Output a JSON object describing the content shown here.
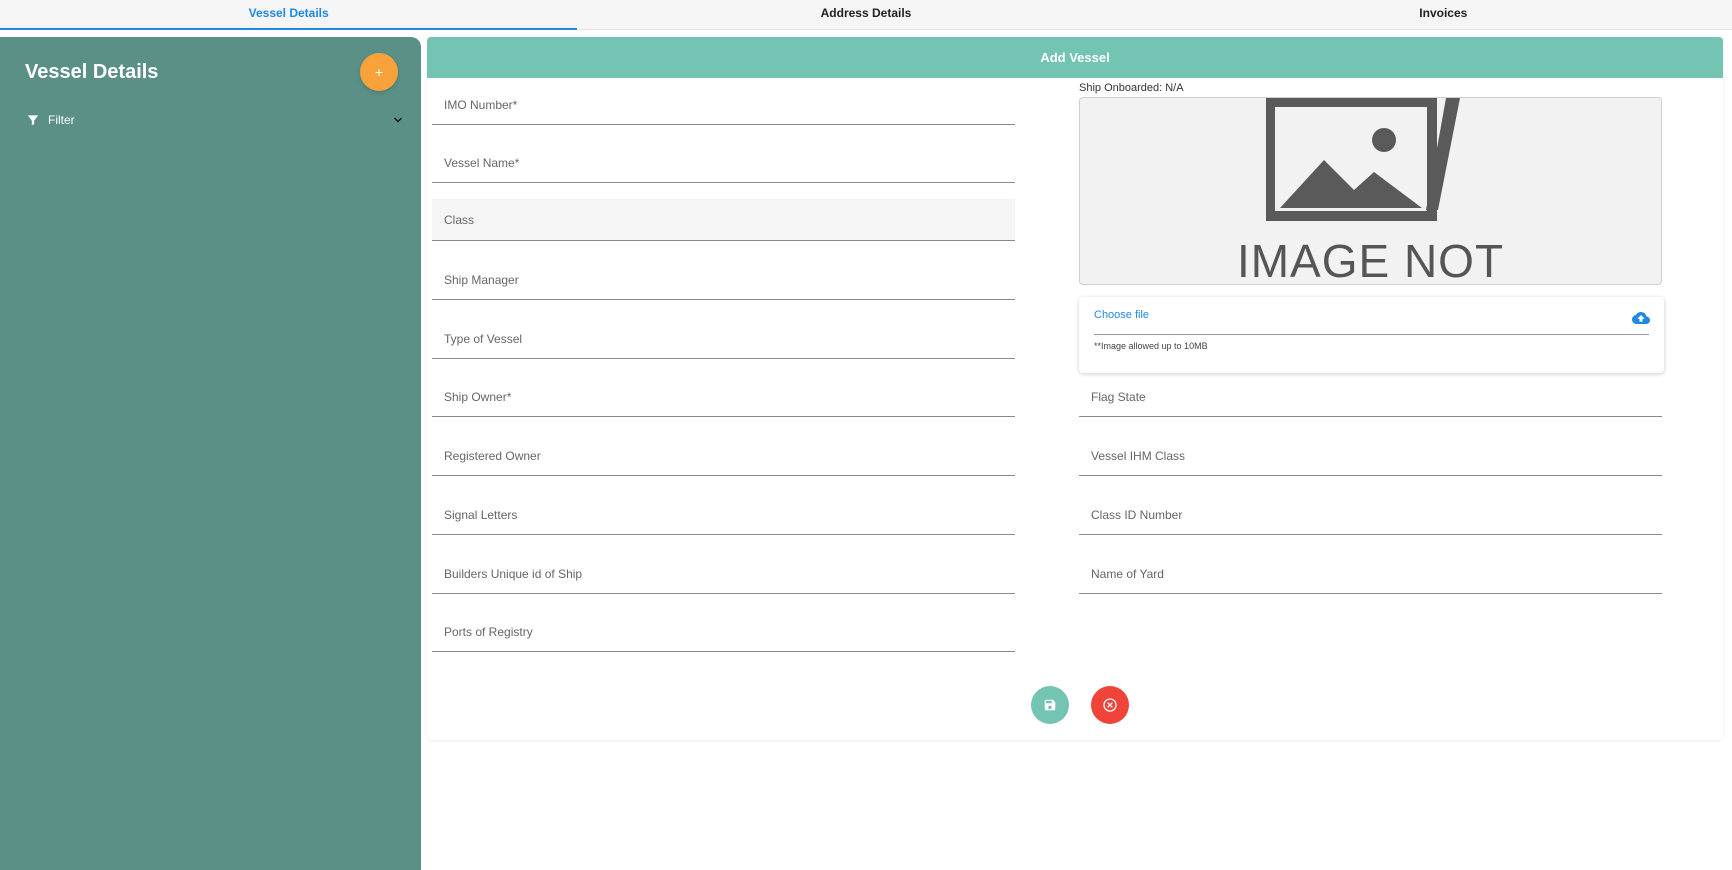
{
  "tabs": [
    {
      "label": "Vessel Details"
    },
    {
      "label": "Address Details"
    },
    {
      "label": "Invoices"
    }
  ],
  "sidebar": {
    "title": "Vessel Details",
    "add_label": "+",
    "filter_label": "Filter"
  },
  "form": {
    "header": "Add Vessel",
    "fields_left": [
      "IMO Number*",
      "Vessel Name*",
      "Class",
      "Ship Manager",
      "Type of Vessel",
      "Ship Owner*",
      "Registered Owner",
      "Signal Letters",
      "Builders Unique id of Ship",
      "Ports of Registry"
    ],
    "fields_right": [
      "Flag State",
      "Vessel IHM Class",
      "Class ID Number",
      "Name of Yard"
    ],
    "ship_onboarded": "Ship Onboarded: N/A",
    "image_placeholder_text": "IMAGE NOT",
    "choose_file": "Choose file",
    "upload_hint": "**Image allowed up to 10MB"
  },
  "colors": {
    "sidebar": "#5b9086",
    "header": "#74c4b3",
    "accent": "#1e88e5",
    "add_button": "#f7a23b",
    "cancel_button": "#f0433a"
  },
  "icons": {
    "filter": "filter-icon",
    "chevron": "chevron-down-icon",
    "upload": "cloud-upload-icon",
    "save": "save-icon",
    "cancel": "close-circle-icon"
  }
}
